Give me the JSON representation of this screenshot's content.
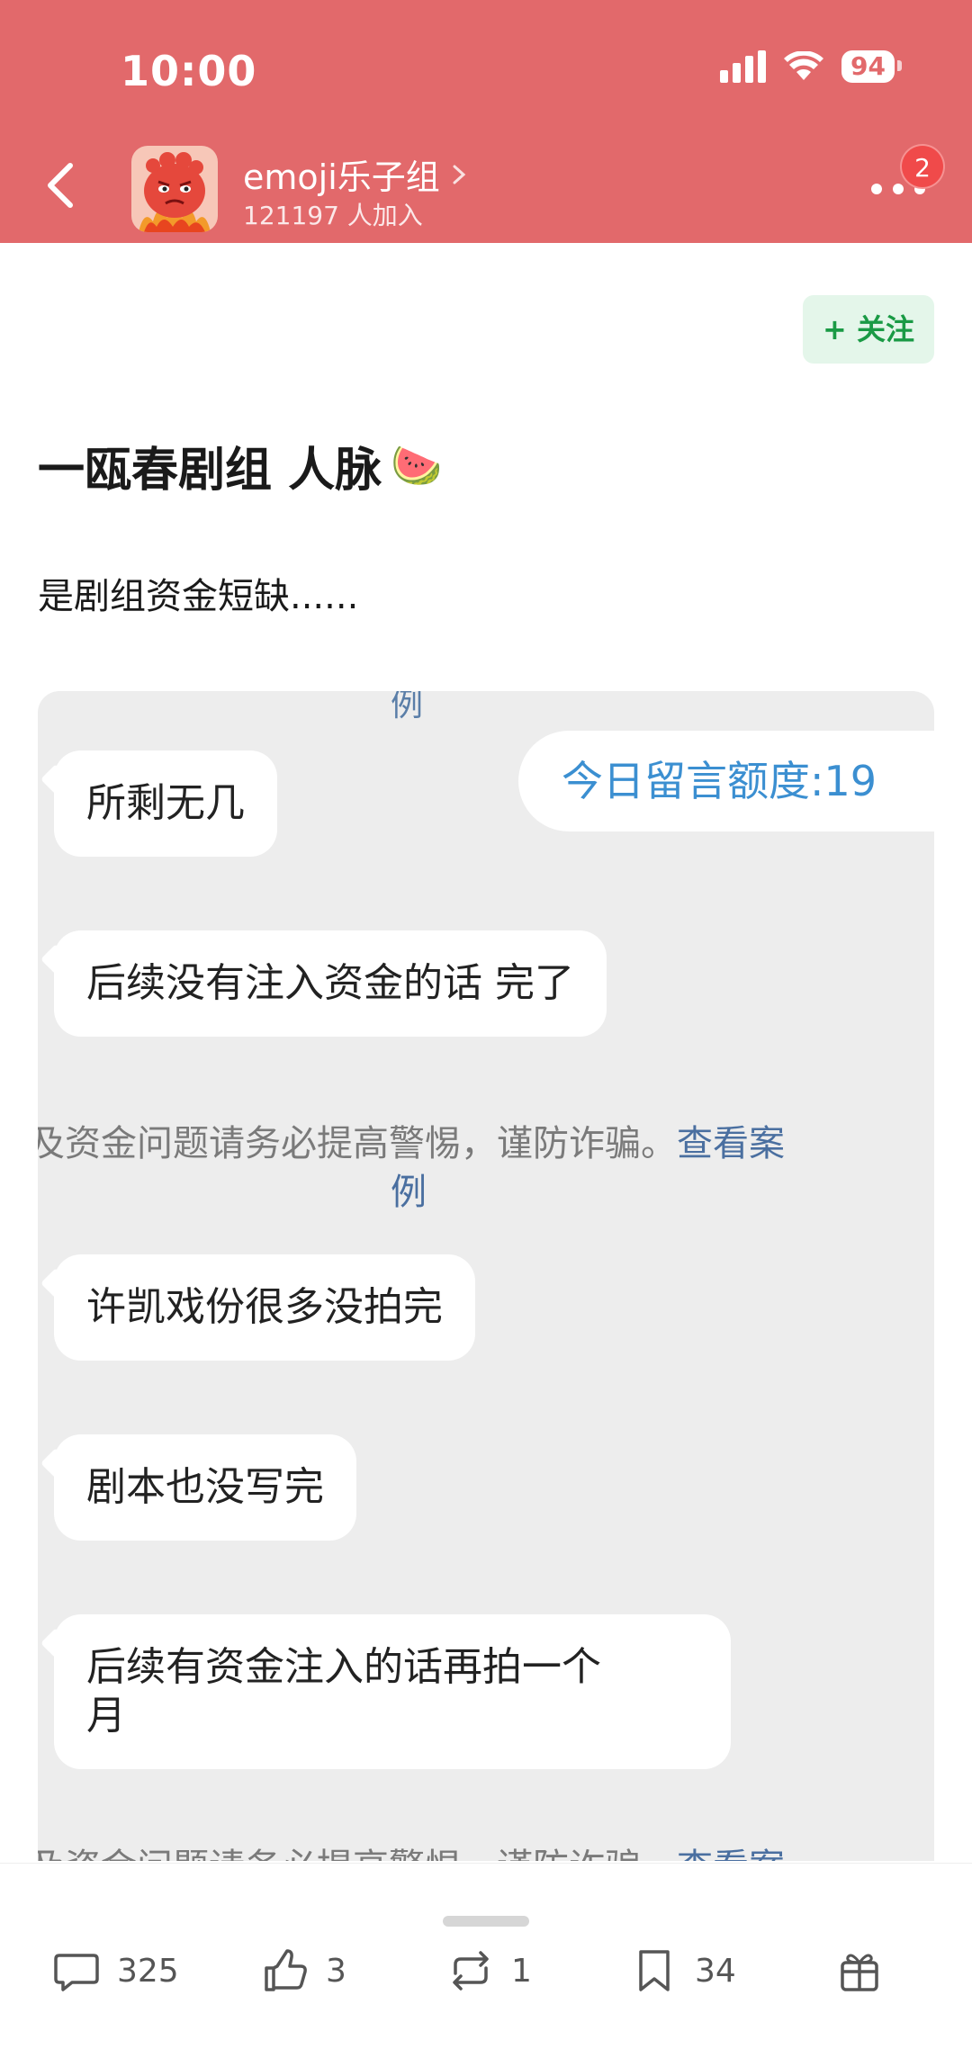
{
  "status_bar": {
    "time": "10:00",
    "battery": "94"
  },
  "header": {
    "group_name": "emoji乐子组",
    "members": "121197 人加入",
    "notification_count": "2"
  },
  "post": {
    "follow_label": "+ 关注",
    "title": "一瓯春剧组 人脉",
    "title_emoji": "🍉",
    "body": "是剧组资金短缺......"
  },
  "chat_screenshot": {
    "top_fragment": "例",
    "quota": "今日留言额度:19",
    "messages": [
      "所剩无几",
      "后续没有注入资金的话 完了",
      "许凯戏份很多没拍完",
      "剧本也没写完",
      "后续有资金注入的话再拍一个\n月"
    ],
    "warning_text": "及资金问题请务必提高警惕，谨防诈骗。",
    "warning_link": "查看案",
    "warning_link_cont": "例"
  },
  "actions": {
    "comments": "325",
    "likes": "3",
    "reposts": "1",
    "saves": "34"
  },
  "colors": {
    "header_bg": "#e2696b",
    "follow_green": "#1a9a45",
    "quota_blue": "#3b8fd1"
  }
}
